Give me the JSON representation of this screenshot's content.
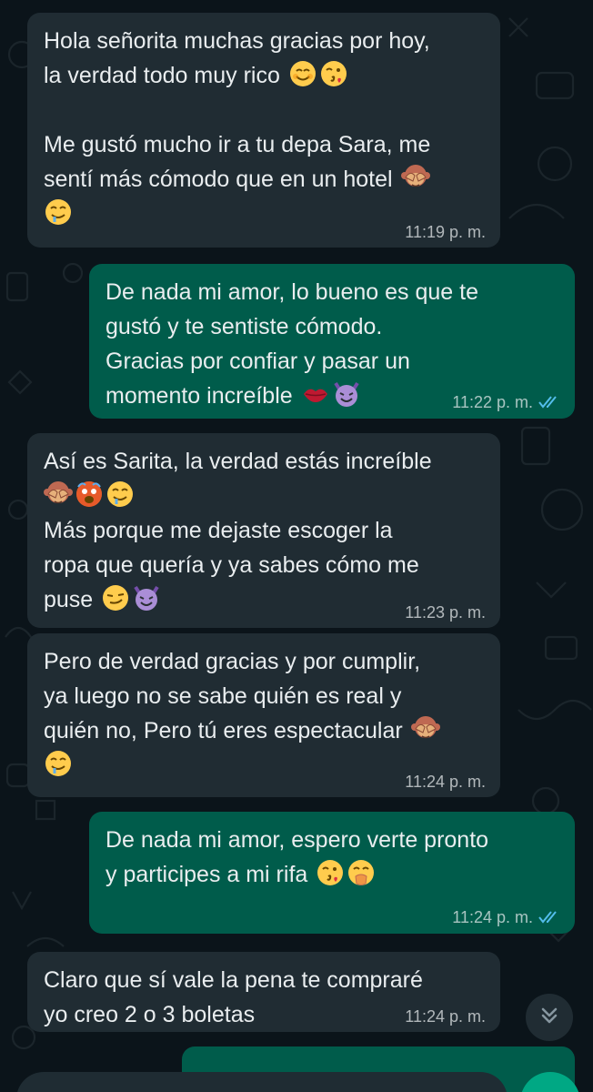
{
  "colors": {
    "background": "#0b141a",
    "incoming_bubble": "#202c33",
    "outgoing_bubble": "#005c4b",
    "read_ticks": "#53bdeb",
    "text": "#e9edef"
  },
  "messages": [
    {
      "direction": "incoming",
      "lines": [
        "Hola señorita muchas gracias por hoy,",
        "la verdad todo muy rico",
        "",
        "Me gustó mucho ir a tu depa Sara, me",
        "sentí más cómodo que en un hotel",
        ""
      ],
      "emojis": [
        "smiling-face-icon",
        "face-blowing-kiss-icon",
        "see-no-evil-monkey-icon",
        "drooling-face-icon"
      ],
      "time": "11:19 p. m."
    },
    {
      "direction": "outgoing",
      "lines": [
        "De nada mi amor, lo bueno es que te",
        "gustó y te sentiste cómodo.",
        "Gracias por confiar y pasar un",
        "momento increíble"
      ],
      "emojis": [
        "kiss-mark-icon",
        "smiling-devil-icon"
      ],
      "time": "11:22 p. m.",
      "status": "read"
    },
    {
      "direction": "incoming",
      "lines": [
        "Así es Sarita, la verdad estás increíble",
        "",
        "Más porque me dejaste escoger la",
        "ropa que quería y ya sabes cómo me",
        "puse"
      ],
      "emojis": [
        "see-no-evil-monkey-icon",
        "hot-face-icon",
        "drooling-face-icon",
        "smirking-face-icon",
        "smiling-devil-icon"
      ],
      "time": "11:23 p. m."
    },
    {
      "direction": "incoming",
      "lines": [
        "Pero de verdad gracias y por cumplir,",
        "ya luego no se sabe quién es real y",
        "quién no, Pero tú eres espectacular",
        ""
      ],
      "emojis": [
        "see-no-evil-monkey-icon",
        "drooling-face-icon"
      ],
      "time": "11:24 p. m."
    },
    {
      "direction": "outgoing",
      "lines": [
        "De nada mi amor, espero verte pronto",
        "y participes a mi rifa"
      ],
      "emojis": [
        "face-blowing-kiss-icon",
        "hand-over-mouth-icon"
      ],
      "time": "11:24 p. m.",
      "status": "read"
    },
    {
      "direction": "incoming",
      "lines": [
        "Claro que sí vale la pena te compraré",
        "yo creo 2 o 3 boletas"
      ],
      "emojis": [],
      "time": "11:24 p. m."
    }
  ],
  "controls": {
    "scroll_down_icon": "double-chevron-down-icon"
  }
}
